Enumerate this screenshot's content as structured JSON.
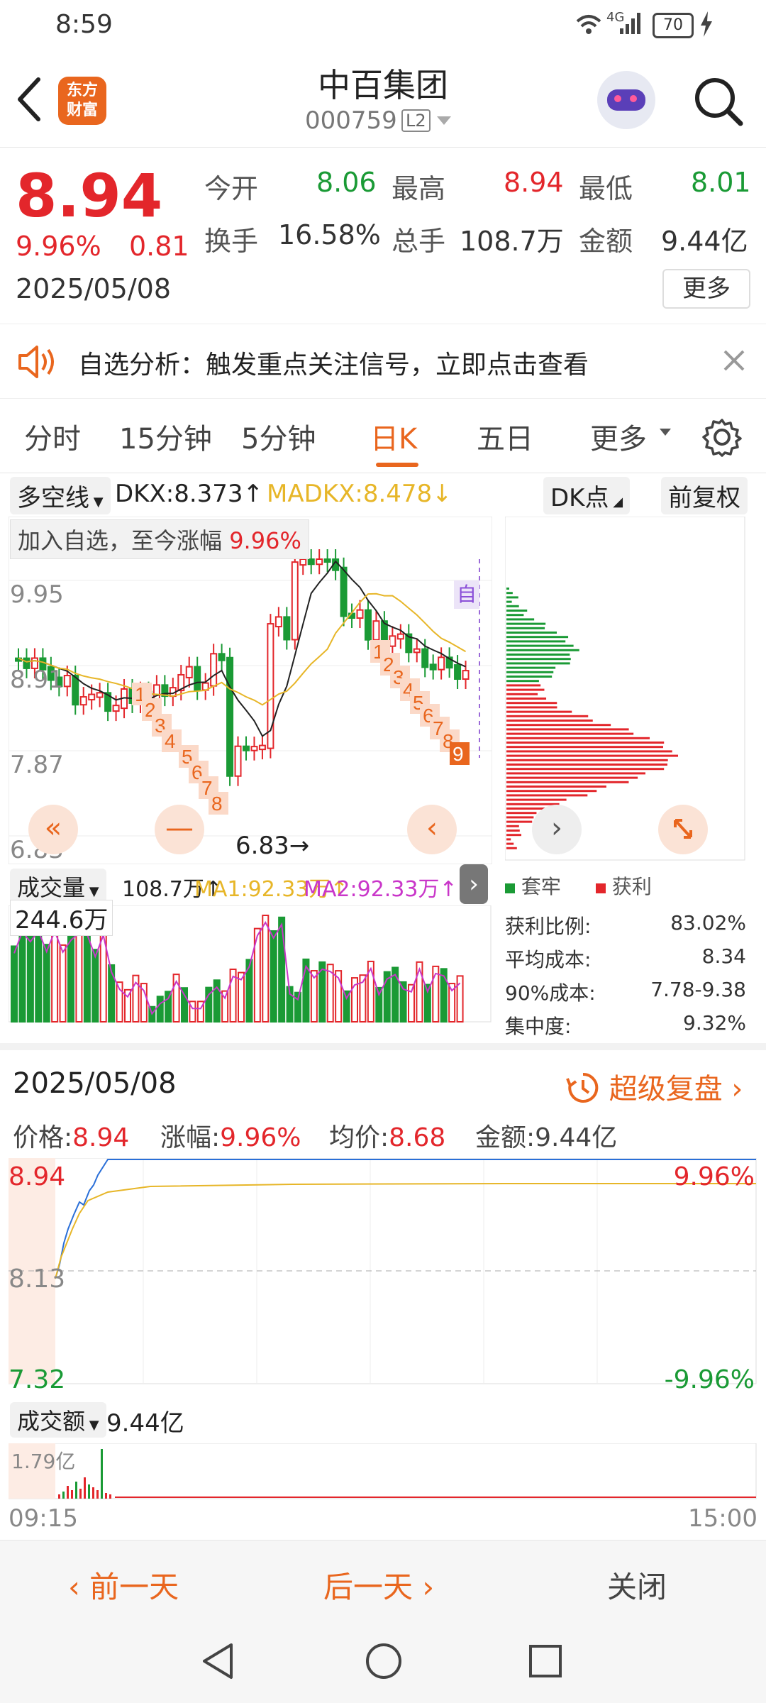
{
  "status_bar": {
    "time": "8:59",
    "network": "4G",
    "battery": "70"
  },
  "header": {
    "title": "中百集团",
    "code": "000759",
    "level_badge": "L2",
    "logo_line1": "东方",
    "logo_line2": "财富"
  },
  "quote": {
    "price": "8.94",
    "change_pct": "9.96%",
    "change": "0.81",
    "date": "2025/05/08",
    "stats": [
      {
        "label": "今开",
        "value": "8.06"
      },
      {
        "label": "最高",
        "value": "8.94"
      },
      {
        "label": "最低",
        "value": "8.01"
      },
      {
        "label": "换手",
        "value": "16.58%"
      },
      {
        "label": "总手",
        "value": "108.7万"
      },
      {
        "label": "金额",
        "value": "9.44亿"
      }
    ],
    "more_button": "更多"
  },
  "banner": {
    "text": "自选分析：触发重点关注信号，立即点击查看"
  },
  "tabs": {
    "items": [
      "分时",
      "15分钟",
      "5分钟",
      "日K",
      "五日",
      "更多"
    ],
    "active": "日K"
  },
  "kline": {
    "indicator_select": "多空线",
    "dkx": "DKX:8.373",
    "madkx": "MADKX:8.478",
    "dk_button": "DK点",
    "adjust_button": "前复权",
    "note_prefix": "加入自选，至今涨幅",
    "note_value": "9.96%",
    "y_labels": [
      "9.95",
      "8.91",
      "7.87",
      "6.83"
    ],
    "low_marker": "6.83",
    "self_marker": "自",
    "volume_select": "成交量",
    "volume_text": "108.7万",
    "ma1": "MA1:92.33万",
    "ma2": "MA2:92.33万",
    "volume_axis": "244.6万",
    "buy_signals": [
      "1",
      "2",
      "3",
      "4",
      "5",
      "6",
      "7",
      "8"
    ],
    "sell_signals": [
      "1",
      "2",
      "3",
      "4",
      "5",
      "6",
      "7",
      "8",
      "9"
    ]
  },
  "chip": {
    "legend_trapped": "套牢",
    "legend_profit": "获利",
    "rows": [
      {
        "label": "获利比例:",
        "value": "83.02%"
      },
      {
        "label": "平均成本:",
        "value": "8.34"
      },
      {
        "label": "90%成本:",
        "value": "7.78-9.38"
      },
      {
        "label": "集中度:",
        "value": "9.32%"
      }
    ]
  },
  "intraday": {
    "date": "2025/05/08",
    "replay": "超级复盘",
    "price_label": "价格:",
    "price": "8.94",
    "change_label": "涨幅:",
    "change": "9.96%",
    "avg_label": "均价:",
    "avg": "8.68",
    "amount_label": "金额:",
    "amount": "9.44亿",
    "y_top": "8.94",
    "y_mid": "8.13",
    "y_bot": "7.32",
    "pct_top": "9.96%",
    "pct_bot": "-9.96%",
    "turnover_select": "成交额",
    "turnover_value": "9.44亿",
    "turnover_axis": "1.79亿",
    "time_start": "09:15",
    "time_end": "15:00"
  },
  "bottom_nav": {
    "prev": "前一天",
    "next": "后一天",
    "close": "关闭"
  },
  "colors": {
    "up": "#e3262b",
    "down": "#1a9a35",
    "accent": "#e9661e",
    "avg_line": "#e7b628"
  }
}
